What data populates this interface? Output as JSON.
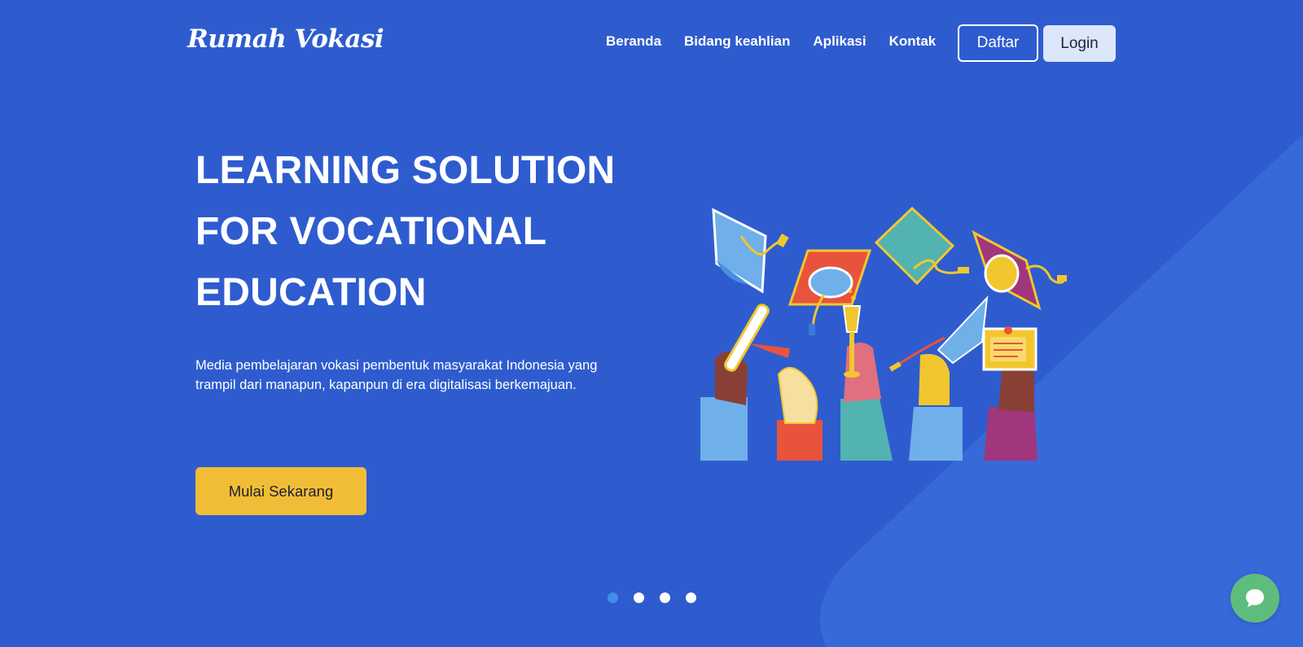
{
  "brand": {
    "logo_text": "Rumah Vokasi"
  },
  "nav": {
    "items": [
      {
        "label": "Beranda"
      },
      {
        "label": "Bidang keahlian"
      },
      {
        "label": "Aplikasi"
      },
      {
        "label": "Kontak"
      }
    ],
    "register_label": "Daftar",
    "login_label": "Login"
  },
  "hero": {
    "title_lines": [
      "LEARNING SOLUTION",
      "FOR VOCATIONAL",
      "EDUCATION"
    ],
    "description": "Media pembelajaran vokasi pembentuk masyarakat Indonesia yang trampil dari manapun, kapanpun di era digitalisasi berkemajuan.",
    "cta_label": "Mulai Sekarang",
    "illustration_icon": "graduation-celebration-illustration"
  },
  "carousel": {
    "slide_count": 4,
    "active_index": 0
  },
  "chat": {
    "icon": "chat-bubble-icon"
  },
  "colors": {
    "background": "#2e5ccf",
    "background_shape": "#3869d9",
    "cta": "#f2bd36",
    "login_button": "#dce7fb",
    "chat_button": "#5ebd7c",
    "active_dot": "#3f8ee8"
  }
}
